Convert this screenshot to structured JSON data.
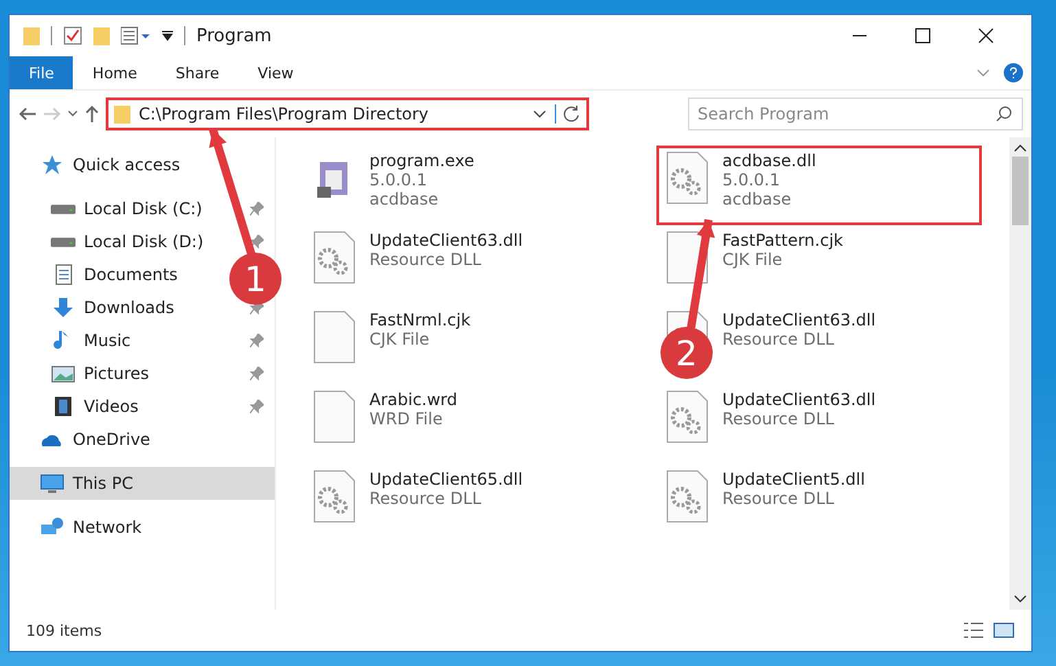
{
  "window": {
    "title": "Program"
  },
  "ribbon_tabs": [
    {
      "label": "File",
      "kind": "file"
    },
    {
      "label": "Home",
      "kind": "tab"
    },
    {
      "label": "Share",
      "kind": "tab"
    },
    {
      "label": "View",
      "kind": "tab"
    }
  ],
  "address": {
    "path": "C:\\Program Files\\Program Directory",
    "highlighted": true
  },
  "search": {
    "placeholder": "Search Program"
  },
  "nav": [
    {
      "label": "Quick access",
      "kind": "star",
      "selected": false,
      "children": [
        {
          "label": "Local Disk (C:)",
          "kind": "drive",
          "pinned": true
        },
        {
          "label": "Local Disk (D:)",
          "kind": "drive",
          "pinned": true
        },
        {
          "label": "Documents",
          "kind": "documents",
          "pinned": false
        },
        {
          "label": "Downloads",
          "kind": "downloads",
          "pinned": true
        },
        {
          "label": "Music",
          "kind": "music",
          "pinned": true
        },
        {
          "label": "Pictures",
          "kind": "pictures",
          "pinned": true
        },
        {
          "label": "Videos",
          "kind": "videos",
          "pinned": true
        }
      ]
    },
    {
      "label": "OneDrive",
      "kind": "cloud",
      "selected": false
    },
    {
      "label": "This PC",
      "kind": "pc",
      "selected": true
    },
    {
      "label": "Network",
      "kind": "network",
      "selected": false
    }
  ],
  "files": [
    {
      "name": "program.exe",
      "lines": [
        "5.0.0.1",
        "acdbase"
      ],
      "kind": "exe",
      "highlighted": false
    },
    {
      "name": "acdbase.dll",
      "lines": [
        "5.0.0.1",
        "acdbase"
      ],
      "kind": "dll",
      "highlighted": true
    },
    {
      "name": "UpdateClient63.dll",
      "lines": [
        "Resource DLL"
      ],
      "kind": "dll",
      "highlighted": false
    },
    {
      "name": "FastPattern.cjk",
      "lines": [
        "CJK File"
      ],
      "kind": "blank",
      "highlighted": false
    },
    {
      "name": "FastNrml.cjk",
      "lines": [
        "CJK File"
      ],
      "kind": "blank",
      "highlighted": false
    },
    {
      "name": "UpdateClient63.dll",
      "lines": [
        "Resource DLL"
      ],
      "kind": "dll",
      "highlighted": false
    },
    {
      "name": "Arabic.wrd",
      "lines": [
        "WRD File"
      ],
      "kind": "blank",
      "highlighted": false
    },
    {
      "name": "UpdateClient63.dll",
      "lines": [
        "Resource DLL"
      ],
      "kind": "dll",
      "highlighted": false
    },
    {
      "name": "UpdateClient65.dll",
      "lines": [
        "Resource DLL"
      ],
      "kind": "dll",
      "highlighted": false
    },
    {
      "name": "UpdateClient5.dll",
      "lines": [
        "Resource DLL"
      ],
      "kind": "dll",
      "highlighted": false
    }
  ],
  "annotations": [
    {
      "label": "1"
    },
    {
      "label": "2"
    }
  ],
  "status_bar": {
    "count": "109 items"
  }
}
